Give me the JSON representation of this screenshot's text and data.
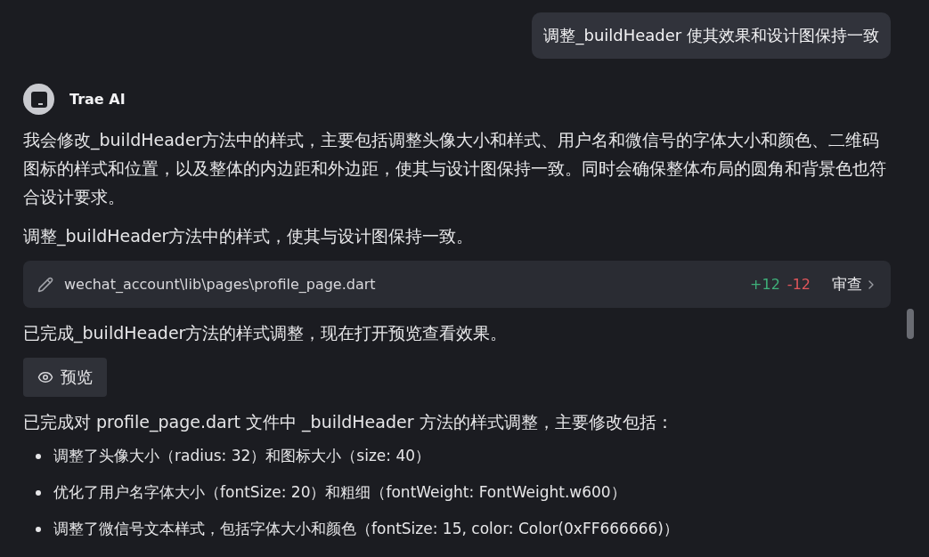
{
  "user_message": "调整_buildHeader 使其效果和设计图保持一致",
  "assistant": {
    "name": "Trae AI"
  },
  "blocks": [
    {
      "kind": "paragraph",
      "text": "我会修改_buildHeader方法中的样式，主要包括调整头像大小和样式、用户名和微信号的字体大小和颜色、二维码图标的样式和位置，以及整体的内边距和外边距，使其与设计图保持一致。同时会确保整体布局的圆角和背景色也符合设计要求。"
    },
    {
      "kind": "paragraph",
      "text": "调整_buildHeader方法中的样式，使其与设计图保持一致。"
    },
    {
      "kind": "file_change",
      "path": "wechat_account\\lib\\pages\\profile_page.dart",
      "added": "+12",
      "removed": "-12",
      "action": "审查"
    },
    {
      "kind": "paragraph",
      "text": "已完成_buildHeader方法的样式调整，现在打开预览查看效果。"
    },
    {
      "kind": "button",
      "label": "预览"
    },
    {
      "kind": "paragraph",
      "text": "已完成对 profile_page.dart 文件中 _buildHeader 方法的样式调整，主要修改包括："
    },
    {
      "kind": "list",
      "items": [
        "调整了头像大小（radius: 32）和图标大小（size: 40）",
        "优化了用户名字体大小（fontSize: 20）和粗细（fontWeight: FontWeight.w600）",
        "调整了微信号文本样式，包括字体大小和颜色（fontSize: 15, color: Color(0xFF666666)）"
      ]
    }
  ]
}
